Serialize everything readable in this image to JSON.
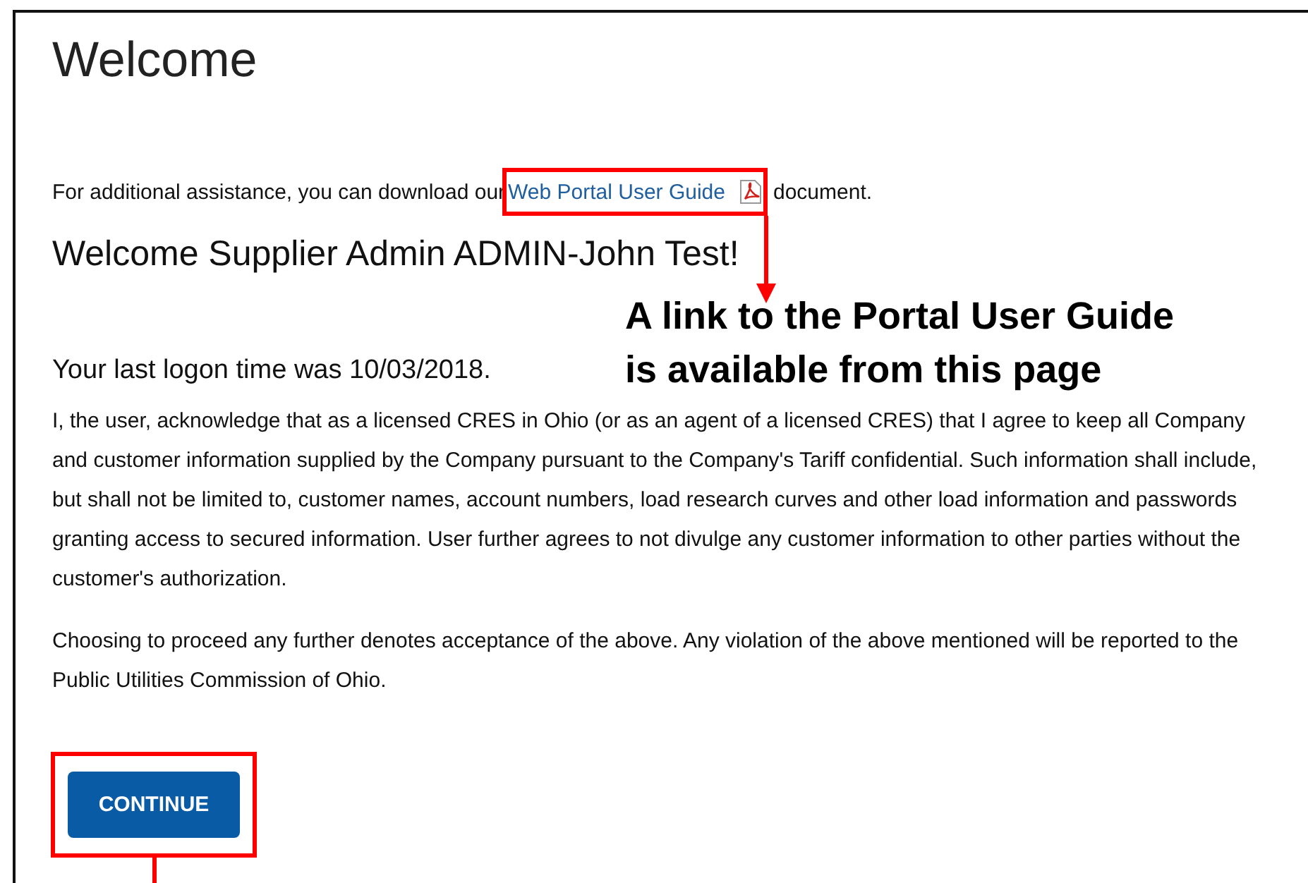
{
  "page": {
    "title": "Welcome",
    "assistance": {
      "before": "For additional assistance, you can download our",
      "link": "Web Portal User Guide",
      "after": "document."
    },
    "greeting": "Welcome Supplier Admin ADMIN-John Test!",
    "last_logon": "Your last logon time was 10/03/2018.",
    "paragraphs": [
      "I, the user, acknowledge that as a licensed CRES in Ohio (or as an agent of a licensed CRES) that I agree to keep all Company and customer information supplied by the Company pursuant to the Company's Tariff confidential. Such information shall include, but shall not be limited to, customer names, account numbers, load research curves and other load information and passwords granting access to secured information. User further agrees to not divulge any customer information to other parties without the customer's authorization.",
      "Choosing to proceed any further denotes acceptance of the above. Any violation of the above mentioned will be reported to the Public Utilities Commission of Ohio."
    ],
    "button": "CONTINUE"
  },
  "annotation": {
    "caption": "A link to the Portal User Guide\nis available from this page"
  }
}
